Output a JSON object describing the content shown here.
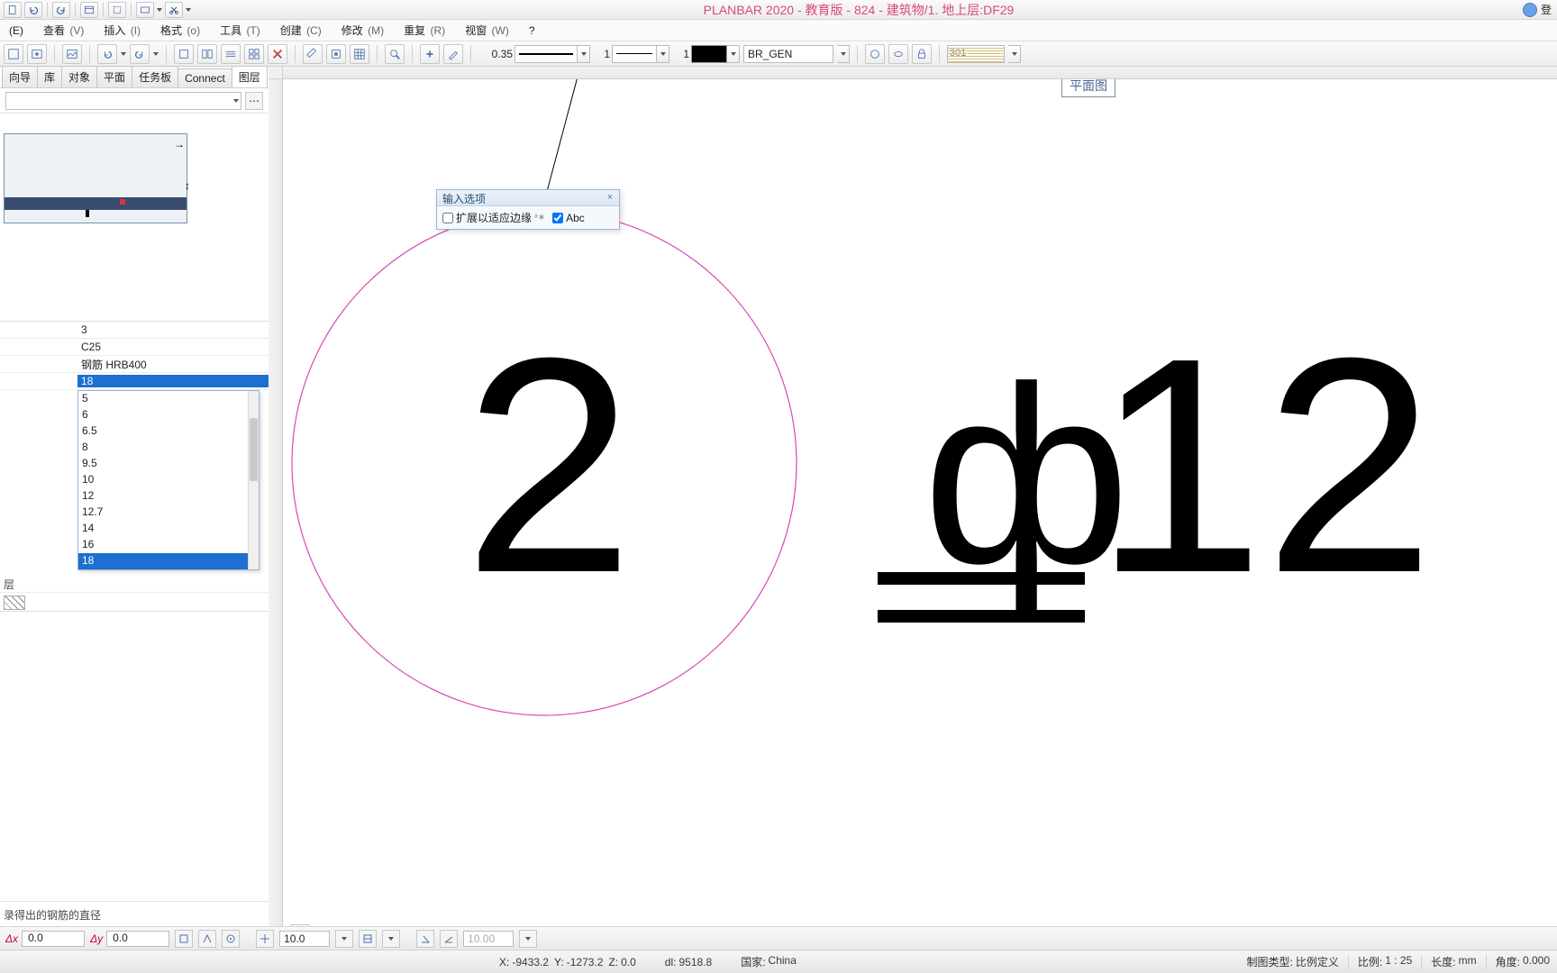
{
  "title": "PLANBAR 2020 - 教育版 - 824 - 建筑物/1. 地上层:DF29",
  "user_label": "登",
  "menu": [
    {
      "t": "(E)"
    },
    {
      "t": "查看",
      "s": "(V)"
    },
    {
      "t": "插入",
      "s": "(I)"
    },
    {
      "t": "格式",
      "s": "(o)"
    },
    {
      "t": "工具",
      "s": "(T)"
    },
    {
      "t": "创建",
      "s": "(C)"
    },
    {
      "t": "修改",
      "s": "(M)"
    },
    {
      "t": "重复",
      "s": "(R)"
    },
    {
      "t": "视窗",
      "s": "(W)"
    },
    {
      "t": "?"
    }
  ],
  "tool": {
    "lw1_label": "0.35",
    "lt1_label": "1",
    "lt2_label": "1",
    "layer": "BR_GEN",
    "hatch_num": "301"
  },
  "sidetabs": [
    "向导",
    "库",
    "对象",
    "平面",
    "任务板",
    "Connect",
    "图层"
  ],
  "props": {
    "r1": "3",
    "r2": "C25",
    "r3": "钢筋 HRB400",
    "r4": "18",
    "r5": "层"
  },
  "diameter_options": [
    "5",
    "6",
    "6.5",
    "8",
    "9.5",
    "10",
    "12",
    "12.7",
    "14",
    "16",
    "18"
  ],
  "diameter_selected_index": 10,
  "hint": "录得出的钢筋的直径",
  "floatbox": {
    "title": "输入选项",
    "cb1": "扩展以适应边缘",
    "cb2": "Abc"
  },
  "planview": "平面图",
  "delta": {
    "dx": "0.0",
    "dy": "0.0",
    "val": "10.0",
    "val2": "10.00"
  },
  "status": {
    "x": "-9433.2",
    "y": "-1273.2",
    "z": "0.0",
    "dl": "9518.8",
    "country_k": "国家:",
    "country_v": "China",
    "plot_k": "制图类型:",
    "plot_v": "比例定义",
    "scale_k": "比例:",
    "scale_v": "1 : 25",
    "len_k": "长度:",
    "len_v": "mm",
    "ang_k": "角度:",
    "ang_v": "0.000"
  },
  "canvas_text": {
    "big2": "2",
    "phi": "ф",
    "twelve": "12"
  }
}
